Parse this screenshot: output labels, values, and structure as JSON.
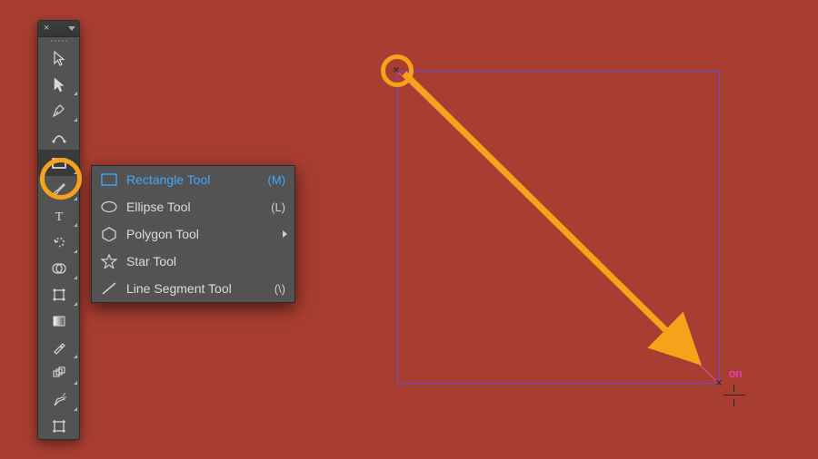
{
  "canvas": {
    "smart_guide_label": "on"
  },
  "toolbar": {
    "tools": [
      {
        "name": "selection",
        "submenu": false
      },
      {
        "name": "direct-selection",
        "submenu": true
      },
      {
        "name": "pen",
        "submenu": true
      },
      {
        "name": "curvature",
        "submenu": false
      },
      {
        "name": "rectangle",
        "submenu": true,
        "active": true
      },
      {
        "name": "paintbrush",
        "submenu": true
      },
      {
        "name": "type",
        "submenu": true
      },
      {
        "name": "rotate",
        "submenu": true
      },
      {
        "name": "shape-builder",
        "submenu": true
      },
      {
        "name": "free-transform",
        "submenu": true
      },
      {
        "name": "gradient",
        "submenu": false
      },
      {
        "name": "eyedropper",
        "submenu": true
      },
      {
        "name": "blend",
        "submenu": true
      },
      {
        "name": "symbol-sprayer",
        "submenu": true
      },
      {
        "name": "artboard",
        "submenu": false
      }
    ]
  },
  "flyout": {
    "items": [
      {
        "label": "Rectangle Tool",
        "shortcut": "(M)",
        "selected": true
      },
      {
        "label": "Ellipse Tool",
        "shortcut": "(L)",
        "selected": false
      },
      {
        "label": "Polygon Tool",
        "shortcut": "",
        "selected": false,
        "submenu": true
      },
      {
        "label": "Star Tool",
        "shortcut": "",
        "selected": false
      },
      {
        "label": "Line Segment Tool",
        "shortcut": "(\\)",
        "selected": false
      }
    ]
  }
}
